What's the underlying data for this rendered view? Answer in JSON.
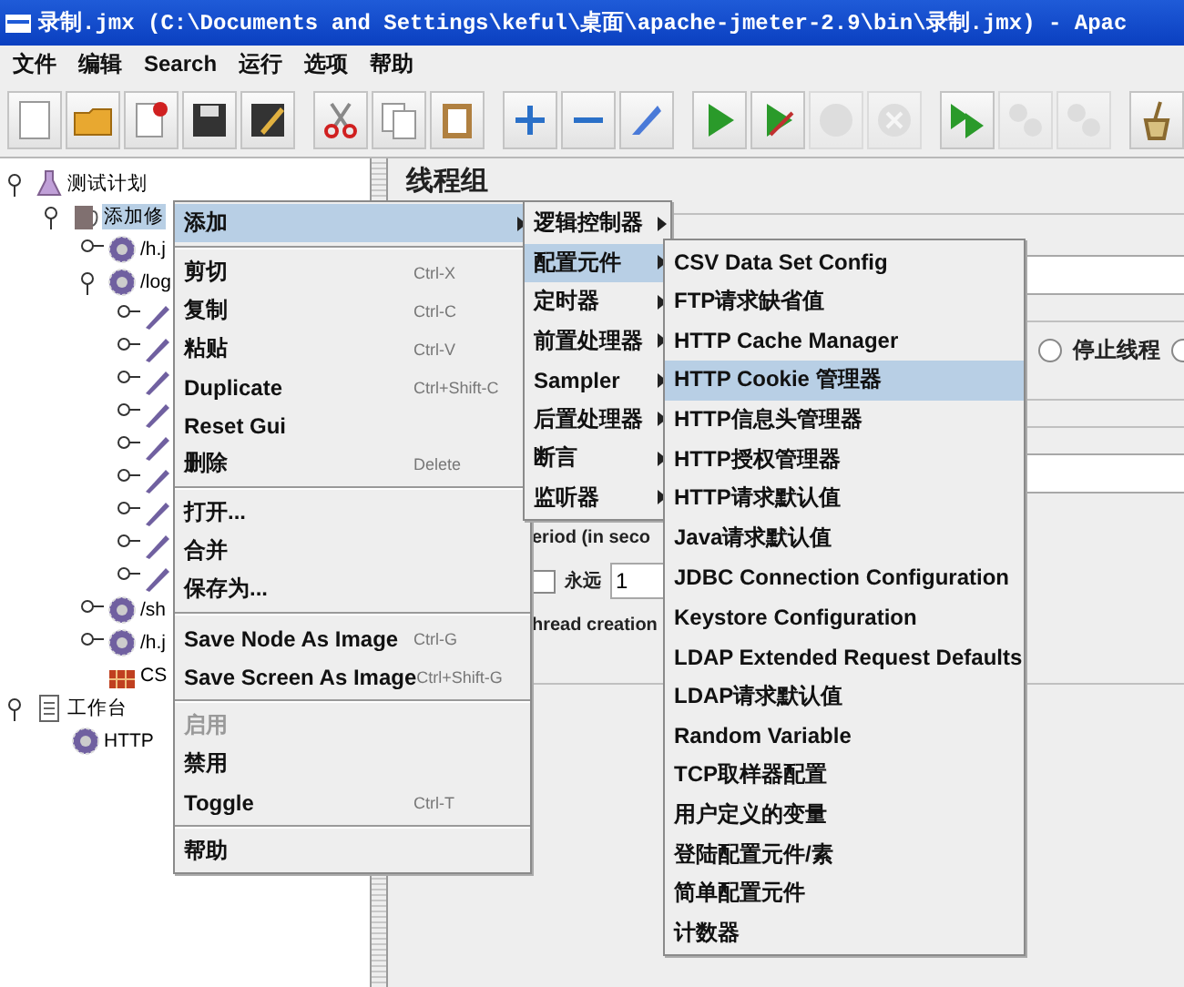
{
  "window": {
    "title": "录制.jmx (C:\\Documents and Settings\\keful\\桌面\\apache-jmeter-2.9\\bin\\录制.jmx) - Apac"
  },
  "menu_bar": [
    "文件",
    "编辑",
    "Search",
    "运行",
    "选项",
    "帮助"
  ],
  "toolbar": [
    {
      "kind": "new",
      "disabled": false
    },
    {
      "kind": "open",
      "disabled": false
    },
    {
      "kind": "close",
      "disabled": false
    },
    {
      "kind": "save",
      "disabled": false
    },
    {
      "kind": "saveas",
      "disabled": false
    },
    {
      "kind": "gap"
    },
    {
      "kind": "cut",
      "disabled": false
    },
    {
      "kind": "copy",
      "disabled": false
    },
    {
      "kind": "paste",
      "disabled": false
    },
    {
      "kind": "gap"
    },
    {
      "kind": "expand",
      "disabled": false
    },
    {
      "kind": "collapse",
      "disabled": false
    },
    {
      "kind": "toggle",
      "disabled": false
    },
    {
      "kind": "gap"
    },
    {
      "kind": "start",
      "disabled": false
    },
    {
      "kind": "startnopause",
      "disabled": false
    },
    {
      "kind": "stop",
      "disabled": true
    },
    {
      "kind": "shutdown",
      "disabled": true
    },
    {
      "kind": "gap"
    },
    {
      "kind": "remotestart",
      "disabled": false
    },
    {
      "kind": "remotestop",
      "disabled": true
    },
    {
      "kind": "remoteshutdown",
      "disabled": true
    },
    {
      "kind": "gap"
    },
    {
      "kind": "clear",
      "disabled": false
    }
  ],
  "tree": [
    {
      "kind": "plan",
      "label": "测试计划",
      "selected": false,
      "expanded": true,
      "children": [
        {
          "kind": "threadgroup",
          "label": "添加修",
          "selected": true,
          "expanded": true,
          "children": [
            {
              "kind": "sampler",
              "label": "/h.j",
              "selected": false,
              "expanded": false
            },
            {
              "kind": "sampler",
              "label": "/log",
              "selected": false,
              "expanded": true,
              "children": [
                {
                  "kind": "pen",
                  "expanded": false
                },
                {
                  "kind": "pen",
                  "expanded": false
                },
                {
                  "kind": "pen",
                  "expanded": false
                },
                {
                  "kind": "pen",
                  "expanded": false
                },
                {
                  "kind": "pen",
                  "expanded": false
                },
                {
                  "kind": "pen",
                  "expanded": false
                },
                {
                  "kind": "pen",
                  "expanded": false
                },
                {
                  "kind": "pen",
                  "expanded": false
                },
                {
                  "kind": "pen",
                  "expanded": false
                }
              ]
            },
            {
              "kind": "sampler",
              "label": "/sh",
              "selected": false,
              "expanded": false
            },
            {
              "kind": "sampler",
              "label": "/h.j",
              "selected": false,
              "expanded": false
            },
            {
              "kind": "csv",
              "label": "CS",
              "selected": false
            }
          ]
        }
      ]
    },
    {
      "kind": "workbench",
      "label": "工作台",
      "selected": false,
      "expanded": true,
      "children": [
        {
          "kind": "sampler",
          "label": "HTTP",
          "selected": false
        }
      ]
    }
  ],
  "right_panel": {
    "title": "线程组",
    "radios": [
      {
        "label": "停止线程",
        "selected": false
      },
      {
        "selected": false
      }
    ],
    "period_label": "eriod (in seco",
    "loop": {
      "label": "永远",
      "checked": false,
      "value": "1"
    },
    "thread_creation_label": "hread creation"
  },
  "context_menu": [
    [
      {
        "label": "添加",
        "has_submenu": true,
        "selected": true,
        "disabled": false
      }
    ],
    [
      {
        "label": "剪切",
        "shortcut": "Ctrl-X",
        "has_submenu": false,
        "selected": false,
        "disabled": false
      },
      {
        "label": "复制",
        "shortcut": "Ctrl-C",
        "has_submenu": false,
        "selected": false,
        "disabled": false
      },
      {
        "label": "粘贴",
        "shortcut": "Ctrl-V",
        "has_submenu": false,
        "selected": false,
        "disabled": false
      },
      {
        "label": "Duplicate",
        "shortcut": "Ctrl+Shift-C",
        "has_submenu": false,
        "selected": false,
        "disabled": false
      },
      {
        "label": "Reset Gui",
        "has_submenu": false,
        "selected": false,
        "disabled": false
      },
      {
        "label": "删除",
        "shortcut": "Delete",
        "has_submenu": false,
        "selected": false,
        "disabled": false
      }
    ],
    [
      {
        "label": "打开...",
        "has_submenu": false,
        "selected": false,
        "disabled": false
      },
      {
        "label": "合并",
        "has_submenu": false,
        "selected": false,
        "disabled": false
      },
      {
        "label": "保存为...",
        "has_submenu": false,
        "selected": false,
        "disabled": false
      }
    ],
    [
      {
        "label": "Save Node As Image",
        "shortcut": "Ctrl-G",
        "has_submenu": false,
        "selected": false,
        "disabled": false
      },
      {
        "label": "Save Screen As Image",
        "shortcut": "Ctrl+Shift-G",
        "has_submenu": false,
        "selected": false,
        "disabled": false
      }
    ],
    [
      {
        "label": "启用",
        "has_submenu": false,
        "selected": false,
        "disabled": true
      },
      {
        "label": "禁用",
        "has_submenu": false,
        "selected": false,
        "disabled": false
      },
      {
        "label": "Toggle",
        "shortcut": "Ctrl-T",
        "has_submenu": false,
        "selected": false,
        "disabled": false
      }
    ],
    [
      {
        "label": "帮助",
        "has_submenu": false,
        "selected": false,
        "disabled": false
      }
    ]
  ],
  "add_submenu": [
    {
      "label": "逻辑控制器",
      "has_submenu": true,
      "selected": false
    },
    {
      "label": "配置元件",
      "has_submenu": true,
      "selected": true
    },
    {
      "label": "定时器",
      "has_submenu": true,
      "selected": false
    },
    {
      "label": "前置处理器",
      "has_submenu": true,
      "selected": false
    },
    {
      "label": "Sampler",
      "has_submenu": true,
      "selected": false
    },
    {
      "label": "后置处理器",
      "has_submenu": true,
      "selected": false
    },
    {
      "label": "断言",
      "has_submenu": true,
      "selected": false
    },
    {
      "label": "监听器",
      "has_submenu": true,
      "selected": false
    }
  ],
  "config_submenu": [
    {
      "label": "CSV Data Set Config",
      "selected": false
    },
    {
      "label": "FTP请求缺省值",
      "selected": false
    },
    {
      "label": "HTTP Cache Manager",
      "selected": false
    },
    {
      "label": "HTTP Cookie 管理器",
      "selected": true
    },
    {
      "label": "HTTP信息头管理器",
      "selected": false
    },
    {
      "label": "HTTP授权管理器",
      "selected": false
    },
    {
      "label": "HTTP请求默认值",
      "selected": false
    },
    {
      "label": "Java请求默认值",
      "selected": false
    },
    {
      "label": "JDBC Connection Configuration",
      "selected": false
    },
    {
      "label": "Keystore Configuration",
      "selected": false
    },
    {
      "label": "LDAP Extended Request Defaults",
      "selected": false
    },
    {
      "label": "LDAP请求默认值",
      "selected": false
    },
    {
      "label": "Random Variable",
      "selected": false
    },
    {
      "label": "TCP取样器配置",
      "selected": false
    },
    {
      "label": "用户定义的变量",
      "selected": false
    },
    {
      "label": "登陆配置元件/素",
      "selected": false
    },
    {
      "label": "简单配置元件",
      "selected": false
    },
    {
      "label": "计数器",
      "selected": false
    }
  ]
}
